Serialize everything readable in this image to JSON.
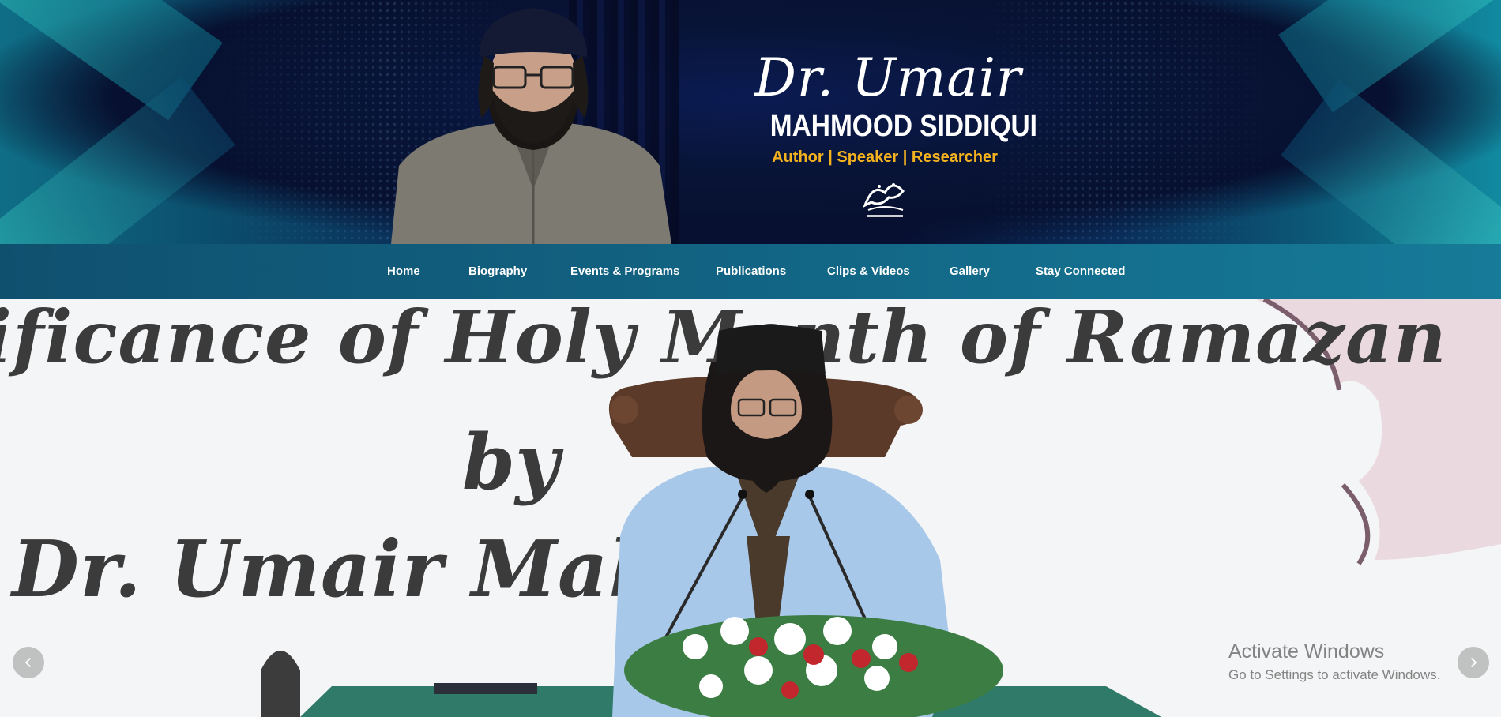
{
  "banner": {
    "brand": {
      "script_name": "Dr. Umair",
      "full_name": "MAHMOOD SIDDIQUI",
      "tagline": "Author | Speaker | Researcher",
      "logo_text": "Dr. Umair Mahmood"
    },
    "colors": {
      "tagline": "#f5b21f",
      "background": "#070f32",
      "accent_teal": "#118aa0"
    }
  },
  "nav": {
    "items": [
      {
        "label": "Home"
      },
      {
        "label": "Biography"
      },
      {
        "label": "Events & Programs"
      },
      {
        "label": "Publications"
      },
      {
        "label": "Clips & Videos"
      },
      {
        "label": "Gallery"
      },
      {
        "label": "Stay Connected"
      }
    ]
  },
  "hero": {
    "title_line1": "ificance of Holy Month of Ramazan",
    "title_line2": "by",
    "title_line3": "Dr. Umair Mahmo          i",
    "prev_icon": "chevron-left-icon",
    "next_icon": "chevron-right-icon"
  },
  "os_watermark": {
    "title": "Activate Windows",
    "subtitle": "Go to Settings to activate Windows."
  }
}
